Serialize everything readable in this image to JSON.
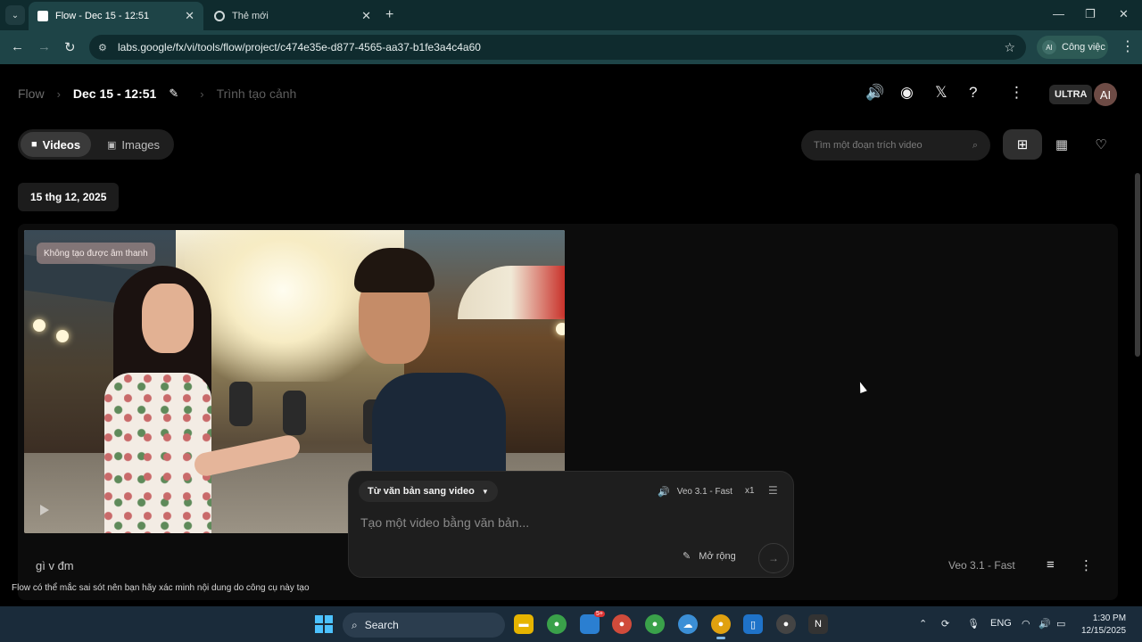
{
  "browser": {
    "tabs": [
      {
        "title": "Flow - Dec 15 - 12:51",
        "active": true
      },
      {
        "title": "Thẻ mới",
        "active": false
      }
    ],
    "url": "labs.google/fx/vi/tools/flow/project/c474e35e-d877-4565-aa37-b1fe3a4c4a60",
    "profile_label": "Công việc",
    "profile_initials": "AI"
  },
  "header": {
    "crumb_root": "Flow",
    "crumb_project": "Dec 15 - 12:51",
    "crumb_scene": "Trình tạo cảnh",
    "plan_badge": "ULTRA",
    "avatar_initials": "AI",
    "icons": [
      "volume-icon",
      "discord-icon",
      "x-icon",
      "help-icon",
      "more-vert-icon"
    ]
  },
  "toolbar": {
    "tab_videos": "Videos",
    "tab_images": "Images",
    "search_placeholder": "Tìm một đoạn trích video",
    "view_modes": [
      "grid-large-icon",
      "grid-small-icon",
      "favorites-icon"
    ]
  },
  "content": {
    "date_label": "15 thg 12, 2025",
    "clip": {
      "badge": "Không tạo được âm thanh",
      "caption": "gì v đm",
      "model": "Veo 3.1 - Fast"
    }
  },
  "composer": {
    "mode": "Từ văn bản sang video",
    "model": "Veo 3.1 - Fast",
    "count": "x1",
    "placeholder": "Tạo một video bằng văn bản...",
    "expand_label": "Mở rộng"
  },
  "disclaimer": "Flow có thể mắc sai sót nên bạn hãy xác minh nội dung do công cụ này tạo",
  "taskbar": {
    "search_label": "Search",
    "language": "ENG",
    "time": "1:30 PM",
    "date": "12/15/2025",
    "mail_badge": "5+"
  },
  "colors": {
    "tab_strip": "#0f2b2e",
    "toolbar": "#1e4447",
    "app_bg": "#000000",
    "taskbar": "#1a2b3a"
  }
}
